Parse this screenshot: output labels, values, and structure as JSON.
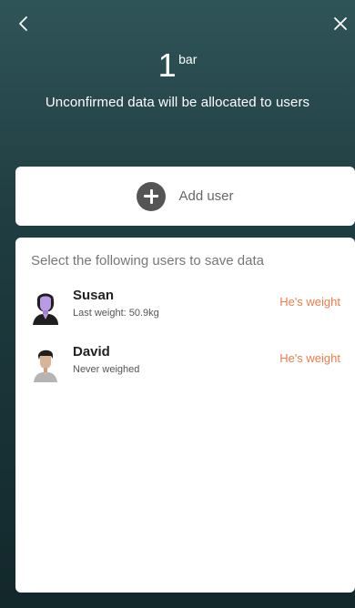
{
  "header": {
    "back_icon": "chevron-left-icon",
    "close_icon": "close-icon",
    "reading_value": "1",
    "reading_unit": "bar",
    "subtitle": "Unconfirmed data will be allocated to users"
  },
  "add_user": {
    "icon": "plus-circle-icon",
    "label": "Add user"
  },
  "users_panel": {
    "heading": "Select the following users to save data",
    "users": [
      {
        "name": "Susan",
        "subtitle": "Last weight: 50.9kg",
        "action": "He's weight",
        "avatar": "female-avatar-icon"
      },
      {
        "name": "David",
        "subtitle": "Never weighed",
        "action": "He's weight",
        "avatar": "male-avatar-icon"
      }
    ]
  },
  "colors": {
    "background_top": "#2f5458",
    "background_bottom": "#12282b",
    "accent_orange": "#f07a4a",
    "card_bg": "#ffffff"
  }
}
